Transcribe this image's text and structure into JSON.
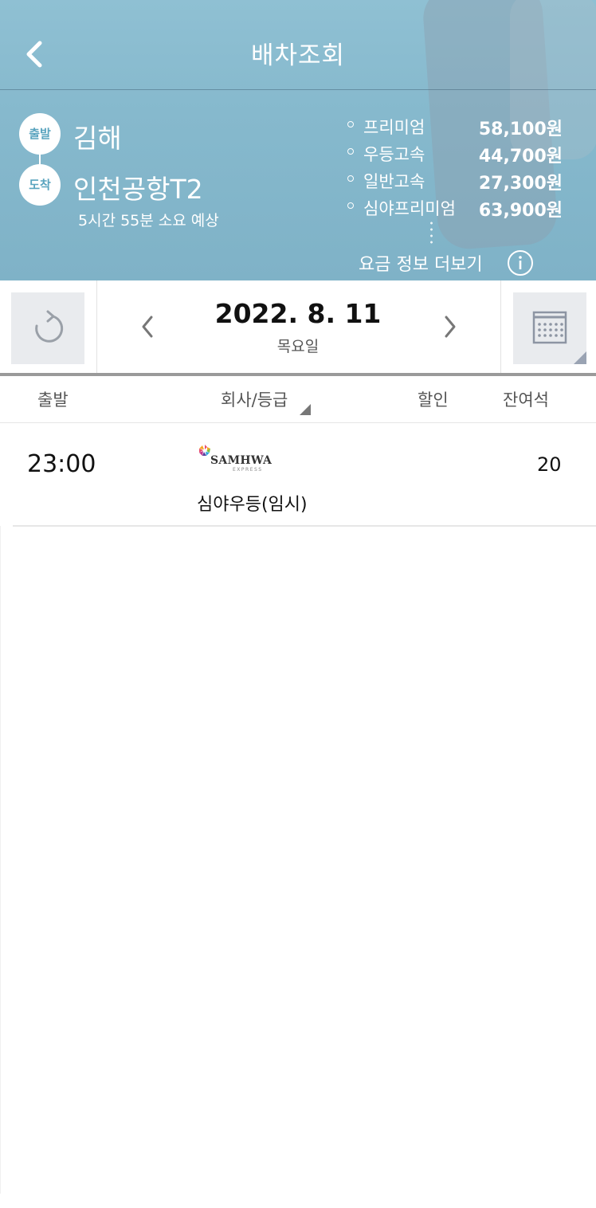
{
  "header": {
    "title": "배차조회"
  },
  "route": {
    "departure_badge": "출발",
    "departure_city": "김해",
    "arrival_badge": "도착",
    "arrival_city": "인천공항T2",
    "duration": "5시간 55분 소요 예상"
  },
  "fares": [
    {
      "name": "프리미엄",
      "price": "58,100원"
    },
    {
      "name": "우등고속",
      "price": "44,700원"
    },
    {
      "name": "일반고속",
      "price": "27,300원"
    },
    {
      "name": "심야프리미엄",
      "price": "63,900원"
    }
  ],
  "more_fare_label": "요금 정보 더보기",
  "date": {
    "value": "2022. 8. 11",
    "weekday": "목요일"
  },
  "columns": {
    "departure": "출발",
    "company_grade": "회사/등급",
    "discount": "할인",
    "seats": "잔여석"
  },
  "schedules": [
    {
      "time": "23:00",
      "company_logo": "SAMHWA",
      "company_logo_sub": "EXPRESS",
      "grade": "심야우등(임시)",
      "discount": "",
      "seats": "20"
    }
  ],
  "icons": {
    "back": "chevron-left-icon",
    "info": "info-icon",
    "refresh": "refresh-icon",
    "prev": "chevron-left-icon",
    "next": "chevron-right-icon",
    "calendar": "calendar-icon"
  },
  "colors": {
    "header_bg": "#86b9cd",
    "badge_text": "#5aa4bf"
  }
}
